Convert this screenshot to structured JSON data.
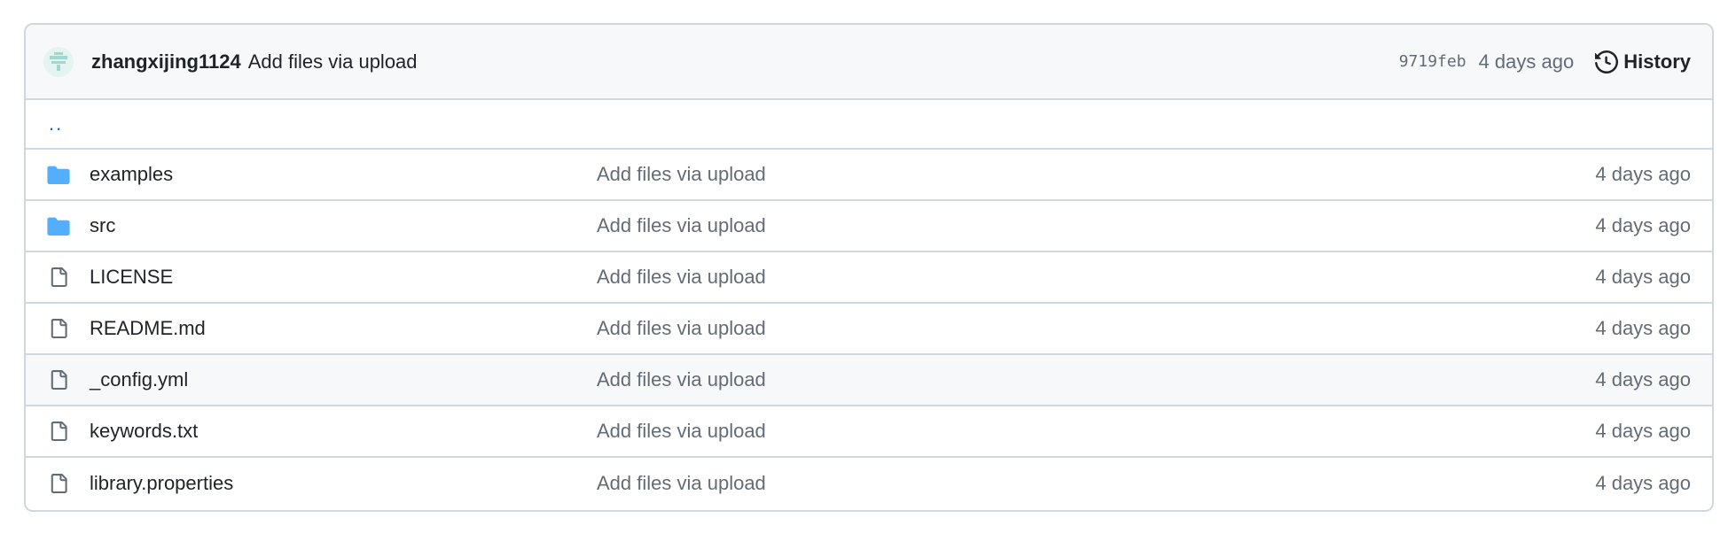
{
  "commit": {
    "author": "zhangxijing1124",
    "message": "Add files via upload",
    "sha": "9719feb",
    "age": "4 days ago",
    "history_label": "History"
  },
  "parent_link": "..",
  "files": [
    {
      "name": "examples",
      "type": "folder",
      "message": "Add files via upload",
      "age": "4 days ago"
    },
    {
      "name": "src",
      "type": "folder",
      "message": "Add files via upload",
      "age": "4 days ago"
    },
    {
      "name": "LICENSE",
      "type": "file",
      "message": "Add files via upload",
      "age": "4 days ago"
    },
    {
      "name": "README.md",
      "type": "file",
      "message": "Add files via upload",
      "age": "4 days ago"
    },
    {
      "name": "_config.yml",
      "type": "file",
      "message": "Add files via upload",
      "age": "4 days ago"
    },
    {
      "name": "keywords.txt",
      "type": "file",
      "message": "Add files via upload",
      "age": "4 days ago"
    },
    {
      "name": "library.properties",
      "type": "file",
      "message": "Add files via upload",
      "age": "4 days ago"
    }
  ],
  "colors": {
    "folder": "#54aeff",
    "file_icon": "#636c76",
    "link": "#0969da",
    "border": "#d0d7de",
    "header_bg": "#f6f8fa"
  },
  "icons": {
    "folder": "folder-icon",
    "file": "file-icon",
    "history": "history-icon"
  }
}
